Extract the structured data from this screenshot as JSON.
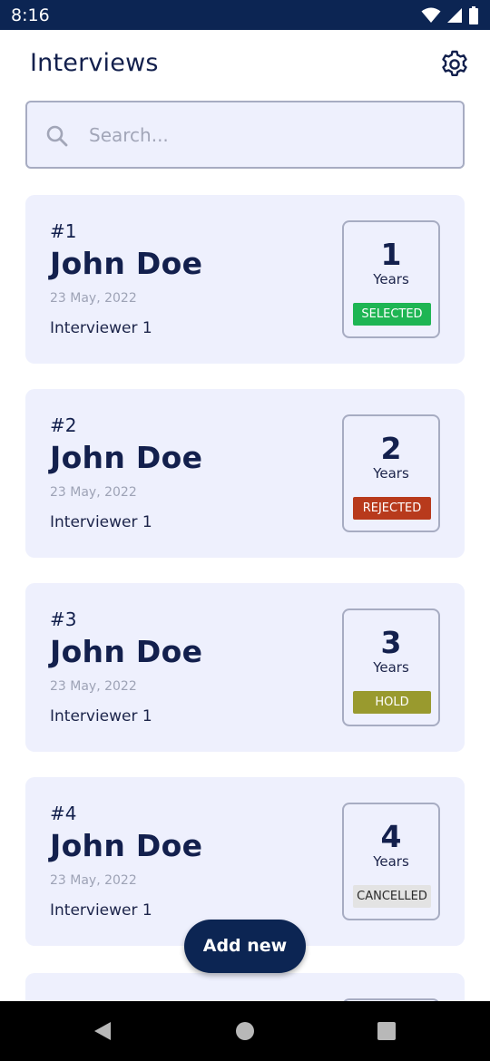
{
  "status_bar": {
    "time": "8:16",
    "icons": [
      "wifi-icon",
      "cellular-signal-icon",
      "battery-icon"
    ]
  },
  "header": {
    "title": "Interviews",
    "settings_icon": "gear-icon"
  },
  "search": {
    "placeholder": "Search...",
    "value": "",
    "icon": "search-icon"
  },
  "interviews": [
    {
      "number": "#1",
      "name": "John Doe",
      "date": "23 May, 2022",
      "interviewer": "Interviewer 1",
      "years": "1",
      "years_label": "Years",
      "status": "SELECTED"
    },
    {
      "number": "#2",
      "name": "John Doe",
      "date": "23 May, 2022",
      "interviewer": "Interviewer 1",
      "years": "2",
      "years_label": "Years",
      "status": "REJECTED"
    },
    {
      "number": "#3",
      "name": "John Doe",
      "date": "23 May, 2022",
      "interviewer": "Interviewer 1",
      "years": "3",
      "years_label": "Years",
      "status": "HOLD"
    },
    {
      "number": "#4",
      "name": "John Doe",
      "date": "23 May, 2022",
      "interviewer": "Interviewer 1",
      "years": "4",
      "years_label": "Years",
      "status": "CANCELLED"
    }
  ],
  "status_colors": {
    "SELECTED": {
      "bg": "#1eb553",
      "fg": "#ffffff"
    },
    "REJECTED": {
      "bg": "#b83a1c",
      "fg": "#ffffff"
    },
    "HOLD": {
      "bg": "#999a2e",
      "fg": "#ffffff"
    },
    "CANCELLED": {
      "bg": "#e3e3e3",
      "fg": "#2a2a2a"
    }
  },
  "fab": {
    "label": "Add new"
  },
  "nav_bar": {
    "buttons": [
      "back-icon",
      "home-icon",
      "recents-icon"
    ]
  },
  "colors": {
    "primary": "#0c2553",
    "card_background": "#eef0fd",
    "text_dark": "#13204d",
    "border": "#a7acc2"
  }
}
